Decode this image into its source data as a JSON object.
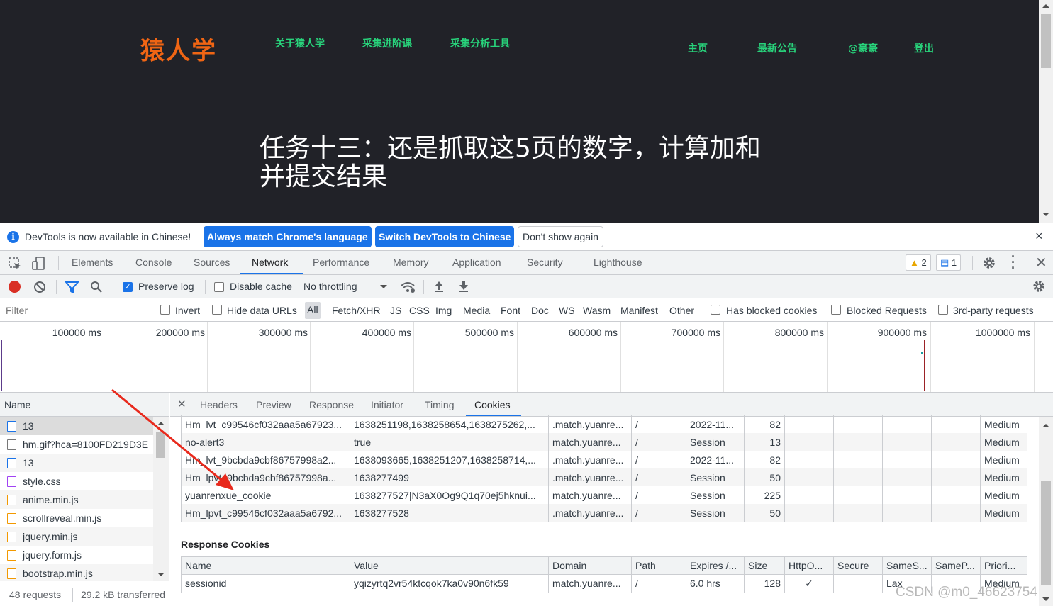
{
  "site": {
    "logo": "猿人学",
    "nav_left": [
      "关于猿人学",
      "采集进阶课",
      "采集分析工具"
    ],
    "nav_right": [
      "主页",
      "最新公告",
      "@豪豪",
      "登出"
    ],
    "task_title": "任务十三：还是抓取这5页的数字，计算加和并提交结果"
  },
  "infobar": {
    "message": "DevTools is now available in Chinese!",
    "btn_match": "Always match Chrome's language",
    "btn_switch": "Switch DevTools to Chinese",
    "btn_dont": "Don't show again",
    "close": "×"
  },
  "tabs": [
    "Elements",
    "Console",
    "Sources",
    "Network",
    "Performance",
    "Memory",
    "Application",
    "Security",
    "Lighthouse"
  ],
  "selected_tab": "Network",
  "badges": {
    "warnings": "2",
    "messages": "1"
  },
  "toolbar": {
    "preserve_log": "Preserve log",
    "disable_cache": "Disable cache",
    "throttling": "No throttling"
  },
  "filterbar": {
    "placeholder": "Filter",
    "invert": "Invert",
    "hide_data_urls": "Hide data URLs",
    "types": [
      "All",
      "Fetch/XHR",
      "JS",
      "CSS",
      "Img",
      "Media",
      "Font",
      "Doc",
      "WS",
      "Wasm",
      "Manifest",
      "Other"
    ],
    "has_blocked": "Has blocked cookies",
    "blocked_requests": "Blocked Requests",
    "third_party": "3rd-party requests"
  },
  "timeline_ticks": [
    "100000 ms",
    "200000 ms",
    "300000 ms",
    "400000 ms",
    "500000 ms",
    "600000 ms",
    "700000 ms",
    "800000 ms",
    "900000 ms",
    "1000000 ms"
  ],
  "requests": {
    "header": "Name",
    "items": [
      {
        "name": "13",
        "type": "doc"
      },
      {
        "name": "hm.gif?hca=8100FD219D3E",
        "type": "img"
      },
      {
        "name": "13",
        "type": "doc"
      },
      {
        "name": "style.css",
        "type": "css"
      },
      {
        "name": "anime.min.js",
        "type": "js"
      },
      {
        "name": "scrollreveal.min.js",
        "type": "js"
      },
      {
        "name": "jquery.min.js",
        "type": "js"
      },
      {
        "name": "jquery.form.js",
        "type": "js"
      },
      {
        "name": "bootstrap.min.js",
        "type": "js"
      }
    ],
    "status_count": "48 requests",
    "status_transfer": "29.2 kB transferred"
  },
  "detail_tabs": [
    "Headers",
    "Preview",
    "Response",
    "Initiator",
    "Timing",
    "Cookies"
  ],
  "selected_detail_tab": "Cookies",
  "request_cookies": [
    {
      "name": "Hm_lvt_c99546cf032aaa5a67923...",
      "value": "1638251198,1638258654,1638275262,...",
      "domain": ".match.yuanre...",
      "path": "/",
      "expires": "2022-11...",
      "size": "82",
      "priority": "Medium"
    },
    {
      "name": "no-alert3",
      "value": "true",
      "domain": "match.yuanre...",
      "path": "/",
      "expires": "Session",
      "size": "13",
      "priority": "Medium"
    },
    {
      "name": "Hm_lvt_9bcbda9cbf86757998a2...",
      "value": "1638093665,1638251207,1638258714,...",
      "domain": ".match.yuanre...",
      "path": "/",
      "expires": "2022-11...",
      "size": "82",
      "priority": "Medium"
    },
    {
      "name": "Hm_lpvt_9bcbda9cbf86757998a...",
      "value": "1638277499",
      "domain": ".match.yuanre...",
      "path": "/",
      "expires": "Session",
      "size": "50",
      "priority": "Medium"
    },
    {
      "name": "yuanrenxue_cookie",
      "value": "1638277527|N3aX0Og9Q1q70ej5hknui...",
      "domain": "match.yuanre...",
      "path": "/",
      "expires": "Session",
      "size": "225",
      "priority": "Medium"
    },
    {
      "name": "Hm_lpvt_c99546cf032aaa5a6792...",
      "value": "1638277528",
      "domain": ".match.yuanre...",
      "path": "/",
      "expires": "Session",
      "size": "50",
      "priority": "Medium"
    }
  ],
  "response_cookies_title": "Response Cookies",
  "response_columns": [
    "Name",
    "Value",
    "Domain",
    "Path",
    "Expires /...",
    "Size",
    "HttpO...",
    "Secure",
    "SameS...",
    "SameP...",
    "Priori..."
  ],
  "response_cookies": [
    {
      "name": "sessionid",
      "value": "yqizyrtq2vr54ktcqok7ka0v90n6fk59",
      "domain": "match.yuanre...",
      "path": "/",
      "expires": "6.0 hrs",
      "size": "128",
      "httponly": "✓",
      "secure": "",
      "samesite": "Lax",
      "sameparty": "",
      "priority": "Medium"
    }
  ],
  "watermark": "CSDN @m0_46623754",
  "colors": {
    "accent": "#1a73e8",
    "logo": "#f06514",
    "nav": "#28d37b",
    "site_bg": "#212228",
    "arrow": "#e8291c"
  }
}
